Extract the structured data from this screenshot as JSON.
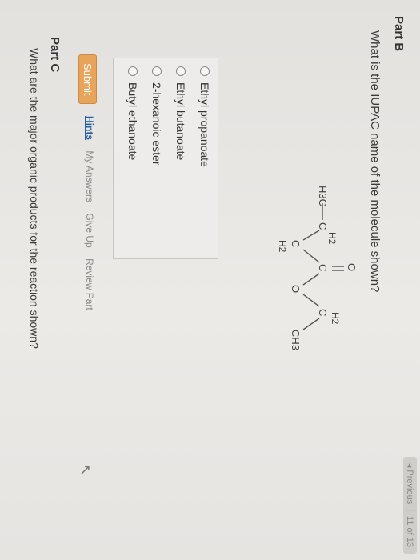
{
  "nav": {
    "prev": "◂ Previous",
    "count": "11 of 13"
  },
  "partB": {
    "title": "Part B",
    "question": "What is the IUPAC name of the molecule shown?",
    "molecule": {
      "h3c": "H3C",
      "h2_top": "H2",
      "c1": "C",
      "c2": "C",
      "h2_bottom": "H2",
      "carbonyl_c": "C",
      "carbonyl_o": "O",
      "ester_o": "O",
      "h2_right": "H2",
      "c3": "C",
      "ch3": "CH3"
    },
    "options": [
      "Ethyl propanoate",
      "Ethyl butanoate",
      "2-hexanoic ester",
      "Butyl ethanoate"
    ]
  },
  "actions": {
    "submit": "Submit",
    "hints": "Hints",
    "my_answers": "My Answers",
    "give_up": "Give Up",
    "review_part": "Review Part"
  },
  "partC": {
    "title": "Part C",
    "question": "What are the major organic products for the reaction shown?"
  }
}
